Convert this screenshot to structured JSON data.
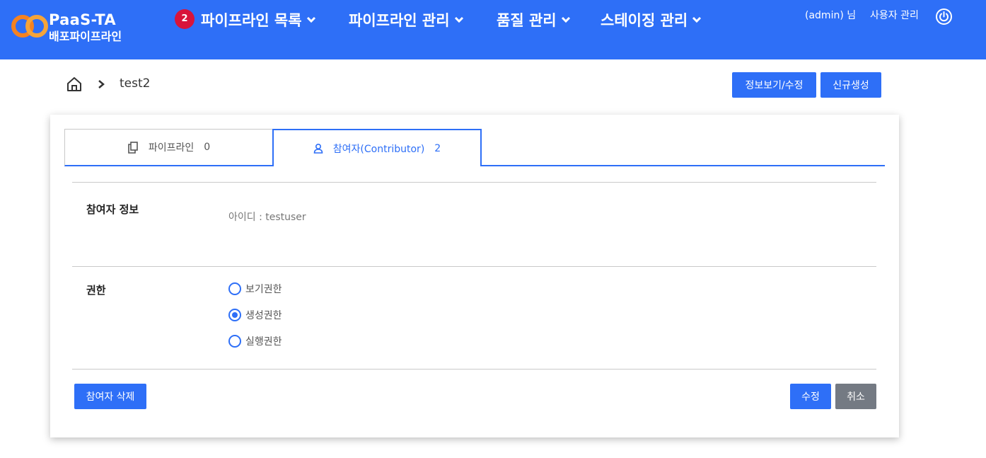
{
  "header": {
    "logo_title": "PaaS-TA",
    "logo_subtitle": "배포파이프라인",
    "badge_count": "2",
    "nav": [
      {
        "label": "파이프라인 목록"
      },
      {
        "label": "파이프라인 관리"
      },
      {
        "label": "품질 관리"
      },
      {
        "label": "스테이징 관리"
      }
    ],
    "user_label": "(admin) 님",
    "user_mgmt": "사용자 관리"
  },
  "breadcrumb": {
    "current": "test2"
  },
  "actions": {
    "info_edit": "정보보기/수정",
    "new": "신규생성"
  },
  "tabs": [
    {
      "label": "파이프라인",
      "count": "0",
      "active": false
    },
    {
      "label": "참여자(Contributor)",
      "count": "2",
      "active": true
    }
  ],
  "contributor": {
    "info_title": "참여자 정보",
    "id_text": "아이디 : testuser",
    "permission_title": "권한",
    "permissions": [
      {
        "label": "보기권한",
        "selected": false
      },
      {
        "label": "생성권한",
        "selected": true
      },
      {
        "label": "실행권한",
        "selected": false
      }
    ],
    "delete_label": "참여자 삭제",
    "edit_label": "수정",
    "cancel_label": "취소"
  },
  "colors": {
    "primary": "#2e6ff7",
    "badge": "#d8143a",
    "cancel": "#747a83",
    "logo_orange": "#f58220"
  }
}
